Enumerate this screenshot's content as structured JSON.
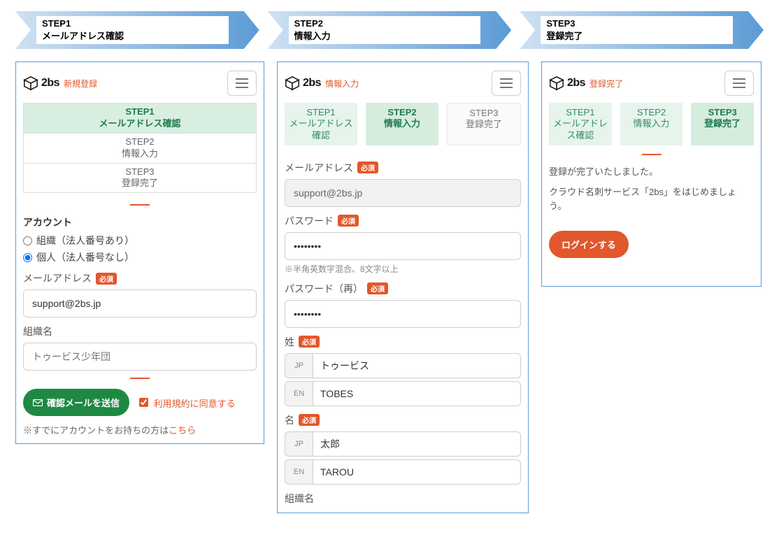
{
  "headers": [
    {
      "title": "STEP1",
      "sub": "メールアドレス確認"
    },
    {
      "title": "STEP2",
      "sub": "情報入力"
    },
    {
      "title": "STEP3",
      "sub": "登録完了"
    }
  ],
  "logo_text": "2bs",
  "panel1": {
    "crumb": "新規登録",
    "steps": [
      {
        "line1": "STEP1",
        "line2": "メールアドレス確認"
      },
      {
        "line1": "STEP2",
        "line2": "情報入力"
      },
      {
        "line1": "STEP3",
        "line2": "登録完了"
      }
    ],
    "section_account": "アカウント",
    "radio_org": "組織（法人番号あり）",
    "radio_ind": "個人（法人番号なし）",
    "label_email": "メールアドレス",
    "required": "必須",
    "value_email": "support@2bs.jp",
    "label_org": "組織名",
    "ph_org": "トゥービス少年団",
    "btn_send": "確認メールを送信",
    "agree": "利用規約に同意する",
    "existing_prefix": "※すでにアカウントをお持ちの方は",
    "existing_link": "こちら"
  },
  "panel2": {
    "crumb": "情報入力",
    "steps": [
      {
        "line1": "STEP1",
        "line2": "メールアドレス確認"
      },
      {
        "line1": "STEP2",
        "line2": "情報入力"
      },
      {
        "line1": "STEP3",
        "line2": "登録完了"
      }
    ],
    "label_email": "メールアドレス",
    "value_email": "support@2bs.jp",
    "label_pw": "パスワード",
    "pw_hint": "※半角英数字混合、8文字以上",
    "label_pw2": "パスワード（再）",
    "value_pw": "••••••••",
    "value_pw2": "••••••••",
    "label_last": "姓",
    "last_jp": "トゥービス",
    "last_en": "TOBES",
    "label_first": "名",
    "first_jp": "太郎",
    "first_en": "TAROU",
    "prefix_jp": "JP",
    "prefix_en": "EN",
    "label_orgname_cut": "組織名"
  },
  "panel3": {
    "crumb": "登録完了",
    "steps": [
      {
        "line1": "STEP1",
        "line2": "メールアドレス確認"
      },
      {
        "line1": "STEP2",
        "line2": "情報入力"
      },
      {
        "line1": "STEP3",
        "line2": "登録完了"
      }
    ],
    "msg1": "登録が完了いたしました。",
    "msg2": "クラウド名刺サービス「2bs」をはじめましょう。",
    "btn_login": "ログインする"
  }
}
